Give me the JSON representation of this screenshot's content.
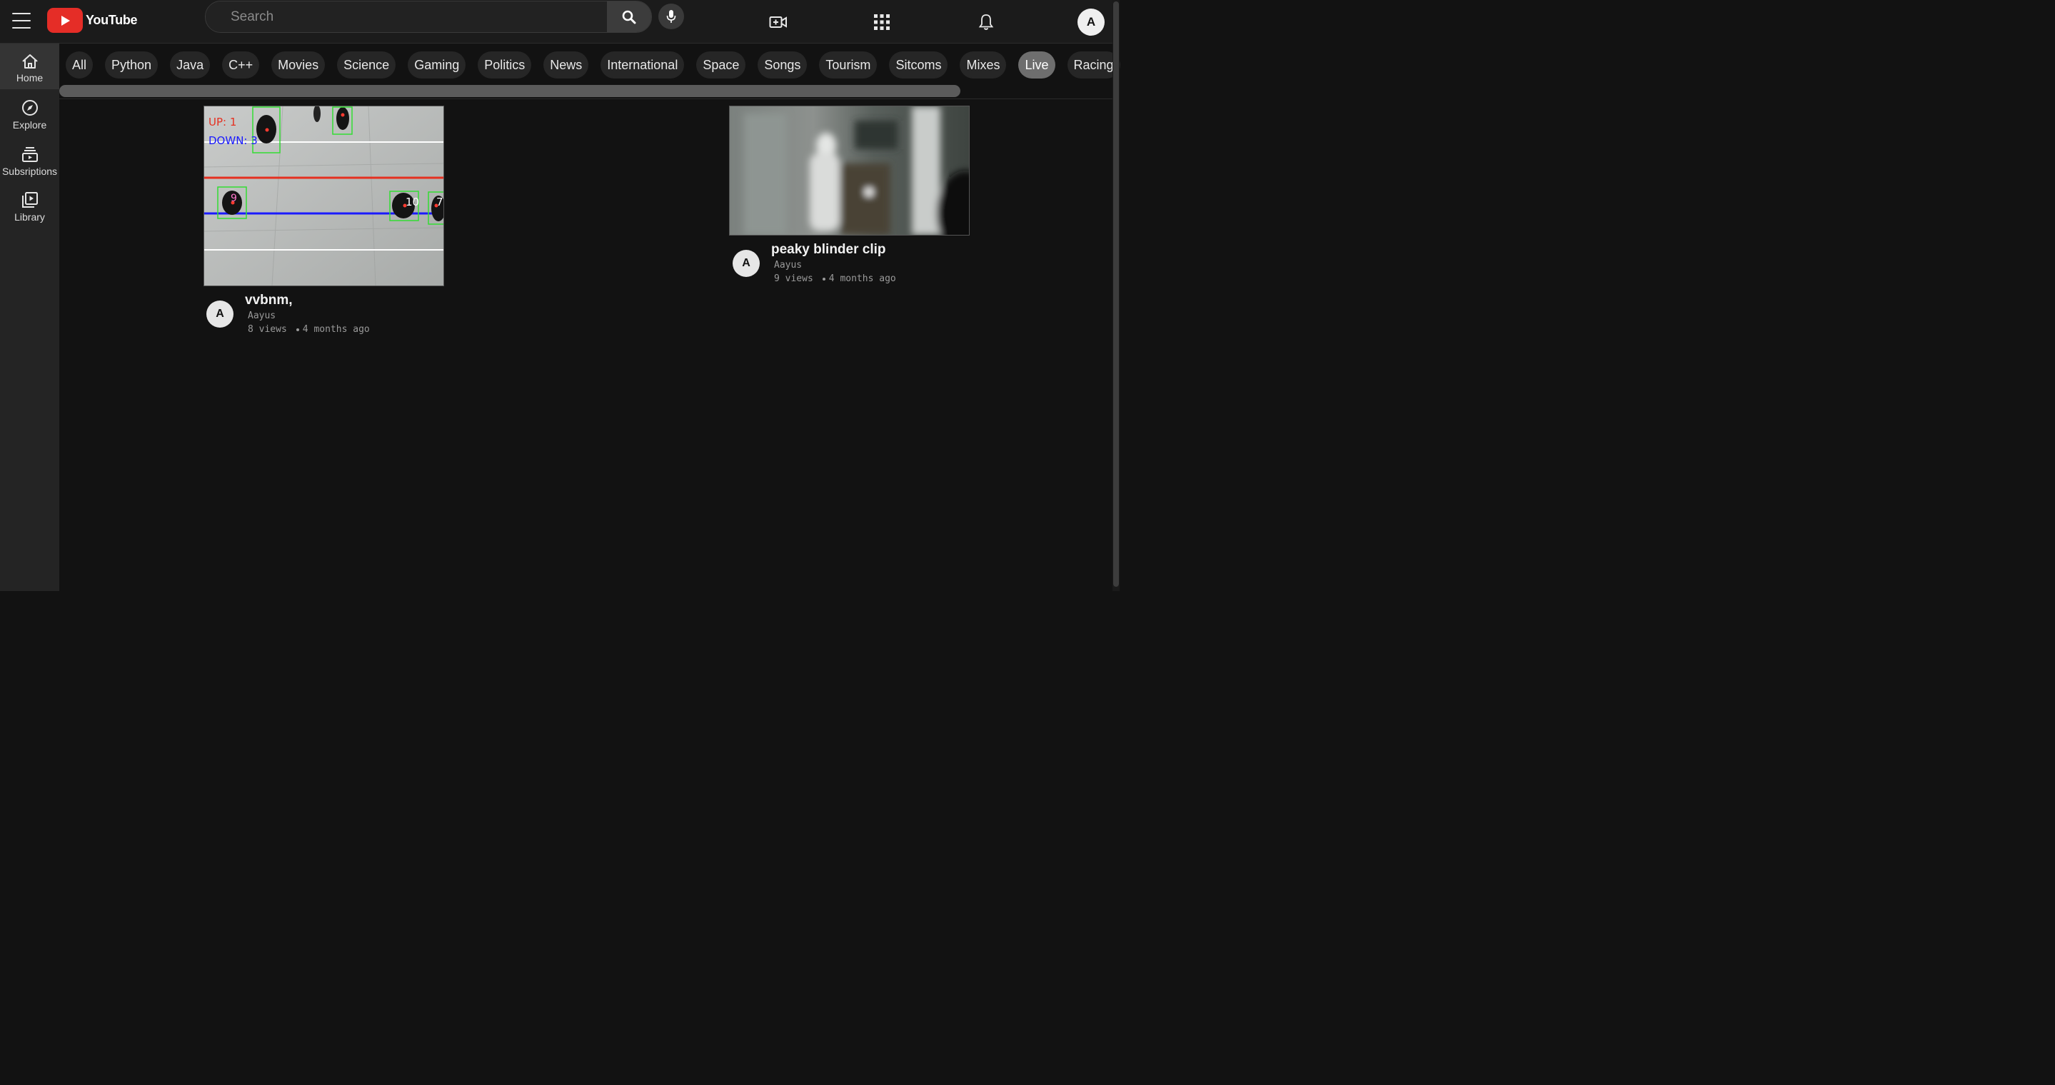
{
  "header": {
    "logo_text": "YouTube",
    "search": {
      "placeholder": "Search",
      "value": ""
    },
    "user_initial": "A",
    "icons": [
      "menu-icon",
      "search-icon",
      "mic-icon",
      "create-video-icon",
      "apps-grid-icon",
      "bell-icon"
    ]
  },
  "sidebar": {
    "items": [
      {
        "label": "Home",
        "icon": "home-icon",
        "active": true
      },
      {
        "label": "Explore",
        "icon": "compass-icon",
        "active": false
      },
      {
        "label": "Subsriptions",
        "icon": "subscriptions-icon",
        "active": false
      },
      {
        "label": "Library",
        "icon": "library-icon",
        "active": false
      }
    ]
  },
  "chips": {
    "items": [
      "All",
      "Python",
      "Java",
      "C++",
      "Movies",
      "Science",
      "Gaming",
      "Politics",
      "News",
      "International",
      "Space",
      "Songs",
      "Tourism",
      "Sitcoms",
      "Mixes",
      "Live",
      "Racing"
    ],
    "active": "Live"
  },
  "videos": [
    {
      "title": "vvbnm,",
      "channel": "Aayus",
      "channel_initial": "A",
      "views": "8 views",
      "age": "4 months ago",
      "overlay": {
        "up": "UP: 1",
        "down": "DOWN: 3",
        "ids": [
          "9",
          "10",
          "7"
        ]
      }
    },
    {
      "title": "peaky blinder clip",
      "channel": "Aayus",
      "channel_initial": "A",
      "views": "9 views",
      "age": "4 months ago"
    }
  ],
  "colors": {
    "background": "#121212",
    "brand_red": "#e52d27",
    "chip_active": "#6e6e6e"
  }
}
